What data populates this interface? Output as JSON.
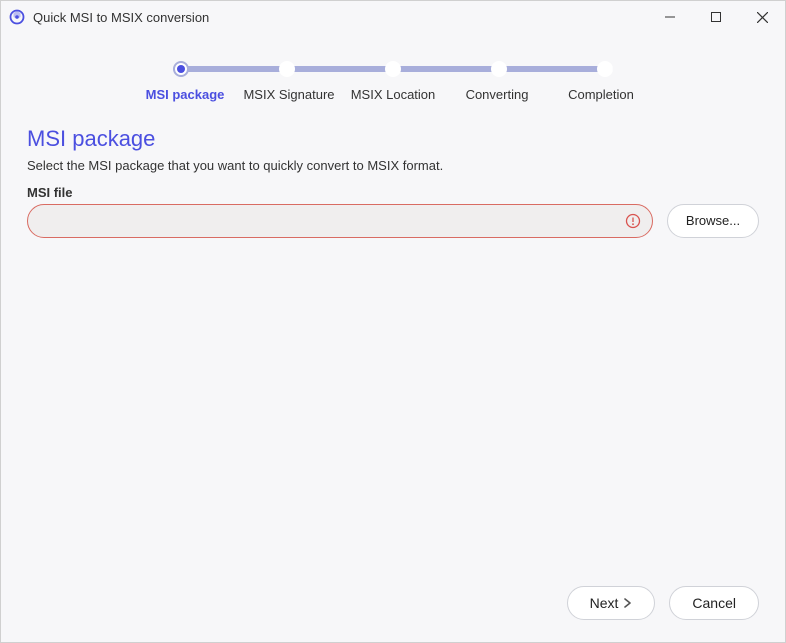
{
  "window": {
    "title": "Quick MSI to MSIX conversion"
  },
  "stepper": {
    "steps": [
      {
        "label": "MSI package",
        "active": true
      },
      {
        "label": "MSIX Signature",
        "active": false
      },
      {
        "label": "MSIX Location",
        "active": false
      },
      {
        "label": "Converting",
        "active": false
      },
      {
        "label": "Completion",
        "active": false
      }
    ]
  },
  "page": {
    "title": "MSI package",
    "description": "Select the MSI package that you want to quickly convert to MSIX format.",
    "field_label": "MSI file",
    "file_value": "",
    "browse_label": "Browse..."
  },
  "footer": {
    "next_label": "Next",
    "cancel_label": "Cancel"
  }
}
